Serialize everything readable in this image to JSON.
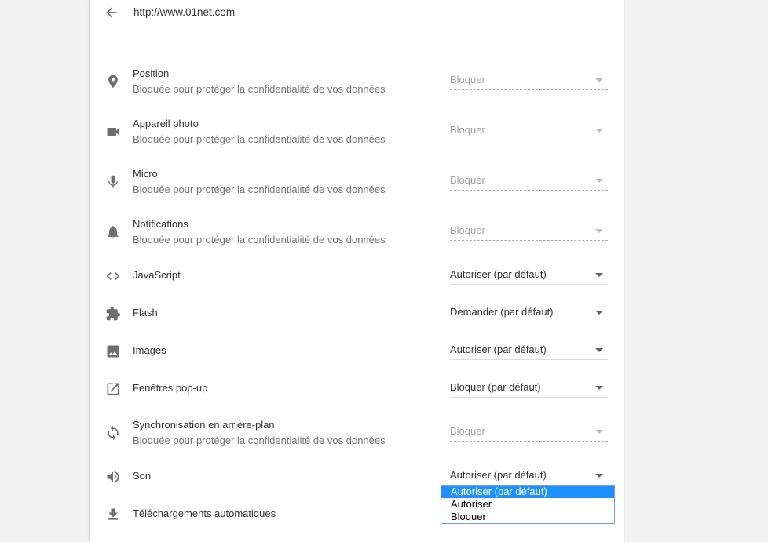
{
  "header": {
    "url": "http://www.01net.com",
    "back_icon": "arrow-back-icon"
  },
  "permissions": [
    {
      "key": "position",
      "icon": "location-pin-icon",
      "title": "Position",
      "subtitle": "Bloquée pour protéger la confidentialité de vos données",
      "value": "Bloquer",
      "disabled": true
    },
    {
      "key": "camera",
      "icon": "videocam-icon",
      "title": "Appareil photo",
      "subtitle": "Bloquée pour protéger la confidentialité de vos données",
      "value": "Bloquer",
      "disabled": true
    },
    {
      "key": "micro",
      "icon": "microphone-icon",
      "title": "Micro",
      "subtitle": "Bloquée pour protéger la confidentialité de vos données",
      "value": "Bloquer",
      "disabled": true
    },
    {
      "key": "notifications",
      "icon": "bell-icon",
      "title": "Notifications",
      "subtitle": "Bloquée pour protéger la confidentialité de vos données",
      "value": "Bloquer",
      "disabled": true
    },
    {
      "key": "javascript",
      "icon": "code-icon",
      "title": "JavaScript",
      "subtitle": "",
      "value": "Autoriser (par défaut)",
      "disabled": false
    },
    {
      "key": "flash",
      "icon": "puzzle-piece-icon",
      "title": "Flash",
      "subtitle": "",
      "value": "Demander (par défaut)",
      "disabled": false
    },
    {
      "key": "images",
      "icon": "image-icon",
      "title": "Images",
      "subtitle": "",
      "value": "Autoriser (par défaut)",
      "disabled": false
    },
    {
      "key": "popups",
      "icon": "open-in-new-icon",
      "title": "Fenêtres pop-up",
      "subtitle": "",
      "value": "Bloquer (par défaut)",
      "disabled": false
    },
    {
      "key": "background-sync",
      "icon": "sync-icon",
      "title": "Synchronisation en arrière-plan",
      "subtitle": "Bloquée pour protéger la confidentialité de vos données",
      "value": "Bloquer",
      "disabled": true
    },
    {
      "key": "sound",
      "icon": "volume-icon",
      "title": "Son",
      "subtitle": "",
      "value": "Autoriser (par défaut)",
      "disabled": false
    },
    {
      "key": "downloads",
      "icon": "download-icon",
      "title": "Téléchargements automatiques",
      "subtitle": "",
      "value": "",
      "disabled": false
    }
  ],
  "sound_dropdown": {
    "options": [
      "Autoriser (par défaut)",
      "Autoriser",
      "Bloquer"
    ],
    "selected_index": 0
  },
  "colors": {
    "highlight": "#1e90ff",
    "dropdown_border": "#7a9cd3",
    "card": "#ffffff",
    "background": "#f2f2f2"
  }
}
